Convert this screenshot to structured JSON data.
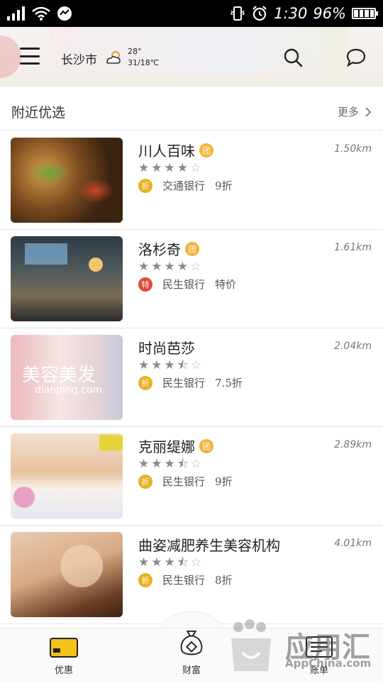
{
  "status_bar": {
    "time": "1:30",
    "battery": "96%"
  },
  "header": {
    "city": "长沙市",
    "weather_icon": "partly-cloudy-icon",
    "temperature_range": "28°",
    "temperature_low": "31/18℃"
  },
  "section": {
    "title": "附近优选",
    "more_label": "更多"
  },
  "items": [
    {
      "name": "川人百味",
      "group_buy": true,
      "group_badge": "团",
      "distance": "1.50km",
      "stars": 4,
      "offer_badge": "折",
      "offer_type": "discount",
      "bank": "交通银行",
      "offer": "9折"
    },
    {
      "name": "洛杉奇",
      "group_buy": true,
      "group_badge": "团",
      "distance": "1.61km",
      "stars": 4,
      "offer_badge": "特",
      "offer_type": "special",
      "bank": "民生银行",
      "offer": "特价"
    },
    {
      "name": "时尚芭莎",
      "group_buy": false,
      "group_badge": "",
      "distance": "2.04km",
      "stars": 3.5,
      "offer_badge": "折",
      "offer_type": "discount",
      "bank": "民生银行",
      "offer": "7.5折"
    },
    {
      "name": "克丽缇娜",
      "group_buy": true,
      "group_badge": "团",
      "distance": "2.89km",
      "stars": 3.5,
      "offer_badge": "折",
      "offer_type": "discount",
      "bank": "民生银行",
      "offer": "9折"
    },
    {
      "name": "曲姿减肥养生美容机构",
      "group_buy": false,
      "group_badge": "",
      "distance": "4.01km",
      "stars": 3.5,
      "offer_badge": "折",
      "offer_type": "discount",
      "bank": "民生银行",
      "offer": "8折"
    }
  ],
  "thumb_texts": {
    "beauty_title": "美容美发",
    "beauty_site": "dianping.com"
  },
  "tabs": {
    "deals": "优惠",
    "wealth": "财富",
    "bills": "账单"
  },
  "watermark": {
    "main": "应用汇",
    "sub": "AppChina.com"
  },
  "colors": {
    "discount_badge": "#e7b223",
    "special_badge": "#e24a3a",
    "group_badge": "#f2b43a"
  }
}
